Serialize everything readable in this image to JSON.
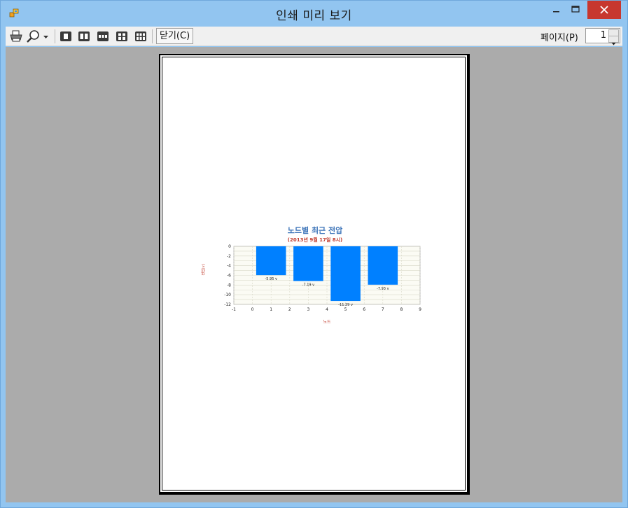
{
  "window": {
    "title": "인쇄 미리 보기",
    "minimize_glyph": "–",
    "maximize_glyph": "□",
    "close_glyph": "✕"
  },
  "toolbar": {
    "print_icon": "printer-icon",
    "zoom_icon": "magnifier-icon",
    "page_layout_icons": [
      "one-page-icon",
      "two-pages-icon",
      "three-pages-icon",
      "four-pages-icon",
      "six-pages-icon"
    ],
    "close_label": "닫기(C)",
    "page_label": "페이지(P)",
    "page_value": "1"
  },
  "colors": {
    "bar": "#0080ff",
    "title": "#3b73b8",
    "accent_red": "#c0392b",
    "close_button": "#c7372f"
  },
  "chart_data": {
    "type": "bar",
    "title": "노드별 최근 전압",
    "subtitle": "(2013년 9월 17일 8시)",
    "xlabel": "노드",
    "ylabel": "전압(v)",
    "xlim": [
      -1,
      9
    ],
    "ylim": [
      -12,
      0
    ],
    "xticks": [
      "-1",
      "0",
      "1",
      "2",
      "3",
      "4",
      "5",
      "6",
      "7",
      "8",
      "9"
    ],
    "yticks": [
      "0",
      "-2",
      "-4",
      "-6",
      "-8",
      "-10",
      "-12"
    ],
    "grid": true,
    "legend": "none",
    "bars": [
      {
        "x": 1,
        "value": -5.95,
        "label": "-5.95 v"
      },
      {
        "x": 3,
        "value": -7.19,
        "label": "-7.19 v"
      },
      {
        "x": 5,
        "value": -11.29,
        "label": "-11.29 v"
      },
      {
        "x": 7,
        "value": -7.93,
        "label": "-7.93 v"
      }
    ]
  }
}
